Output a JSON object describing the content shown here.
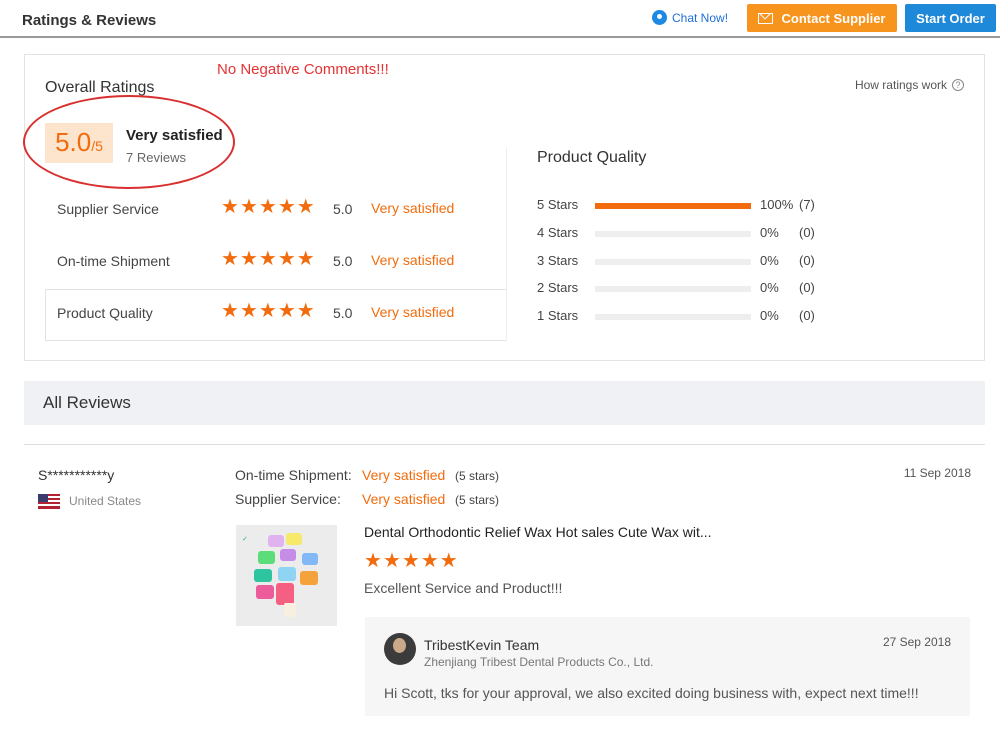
{
  "header": {
    "title": "Ratings & Reviews",
    "chat_now": "Chat Now!",
    "contact_supplier": "Contact Supplier",
    "start_order": "Start Order"
  },
  "annotation": "No Negative Comments!!!",
  "overall": {
    "label": "Overall Ratings",
    "score": "5.0",
    "score_denominator": "/5",
    "text": "Very satisfied",
    "reviews_count": "7 Reviews",
    "how_ratings_work": "How ratings work",
    "help_icon": "?"
  },
  "metrics": [
    {
      "label": "Supplier Service",
      "stars": 5,
      "score": "5.0",
      "text": "Very satisfied"
    },
    {
      "label": "On-time Shipment",
      "stars": 5,
      "score": "5.0",
      "text": "Very satisfied"
    },
    {
      "label": "Product Quality",
      "stars": 5,
      "score": "5.0",
      "text": "Very satisfied"
    }
  ],
  "product_quality": {
    "title": "Product Quality",
    "distribution": [
      {
        "label": "5  Stars",
        "fraction": 1.0,
        "percent": "100%",
        "count": "(7)"
      },
      {
        "label": "4  Stars",
        "fraction": 0,
        "percent": "0%",
        "count": "(0)"
      },
      {
        "label": "3  Stars",
        "fraction": 0,
        "percent": "0%",
        "count": "(0)"
      },
      {
        "label": "2  Stars",
        "fraction": 0,
        "percent": "0%",
        "count": "(0)"
      },
      {
        "label": "1  Stars",
        "fraction": 0,
        "percent": "0%",
        "count": "(0)"
      }
    ]
  },
  "all_reviews": {
    "title": "All Reviews"
  },
  "review": {
    "reviewer": "S***********y",
    "country": "United States",
    "date": "11 Sep 2018",
    "shipment_label": "On-time Shipment:",
    "shipment_value": "Very satisfied",
    "shipment_stars": "(5 stars)",
    "service_label": "Supplier Service:",
    "service_value": "Very satisfied",
    "service_stars": "(5 stars)",
    "product_title": "Dental Orthodontic Relief Wax Hot sales Cute Wax wit...",
    "rating_stars": 5,
    "comment": "Excellent Service and Product!!!",
    "reply": {
      "name": "TribestKevin Team",
      "company": "Zhenjiang Tribest Dental Products Co., Ltd.",
      "date": "27 Sep 2018",
      "text": "Hi Scott, tks for your approval, we also excited doing business with, expect next time!!!"
    }
  },
  "colors": {
    "accent_orange": "#f26c0d",
    "contact_button": "#f7941d",
    "order_button": "#1e88d9",
    "annotation_red": "#d8302f"
  },
  "icons": {
    "chat": "chat-bubble-icon",
    "mail": "mail-icon",
    "star": "star-icon",
    "help": "question-circle-icon",
    "flag": "us-flag-icon"
  }
}
